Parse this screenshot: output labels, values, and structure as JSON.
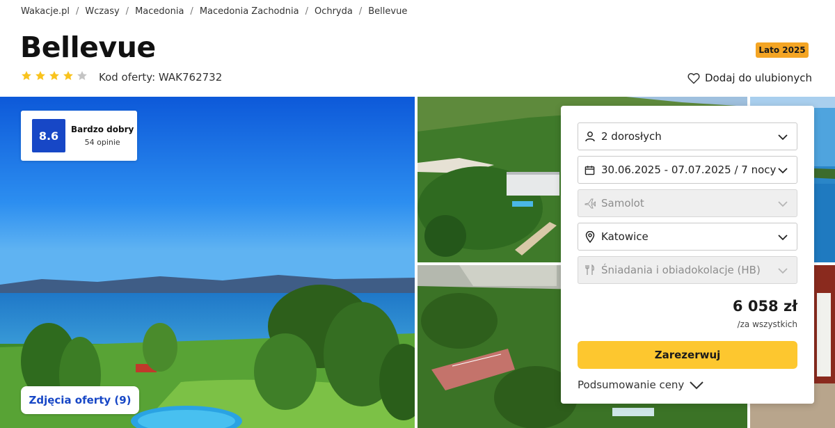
{
  "breadcrumb": [
    "Wakacje.pl",
    "Wczasy",
    "Macedonia",
    "Macedonia Zachodnia",
    "Ochryda",
    "Bellevue"
  ],
  "breadcrumb_separator": "/",
  "hotel": {
    "name": "Bellevue",
    "stars": 4,
    "max_stars": 5,
    "offer_code": "Kod oferty: WAK762732",
    "season_badge": "Lato 2025"
  },
  "favorite_label": "Dodaj do ulubionych",
  "rating": {
    "score": "8.6",
    "label": "Bardzo dobry",
    "count": "54 opinie"
  },
  "photos_button": "Zdjęcia oferty (9)",
  "booking": {
    "fields": [
      {
        "icon": "person-icon",
        "value": "2 dorosłych",
        "disabled": false
      },
      {
        "icon": "calendar-icon",
        "value": "30.06.2025 - 07.07.2025 / 7 nocy",
        "disabled": false
      },
      {
        "icon": "plane-icon",
        "value": "Samolot",
        "disabled": true
      },
      {
        "icon": "location-pin-icon",
        "value": "Katowice",
        "disabled": false
      },
      {
        "icon": "cutlery-icon",
        "value": "Śniadania i obiadokolacje (HB)",
        "disabled": true
      }
    ],
    "price": "6 058 zł",
    "price_note": "/za wszystkich",
    "reserve_label": "Zarezerwuj",
    "summary_label": "Podsumowanie ceny"
  },
  "colors": {
    "accent_blue": "#1747c6",
    "reserve_yellow": "#fdc72f",
    "badge_orange": "#f4a524",
    "star_yellow": "#f9c31d",
    "star_grey": "#c4c4c4"
  }
}
